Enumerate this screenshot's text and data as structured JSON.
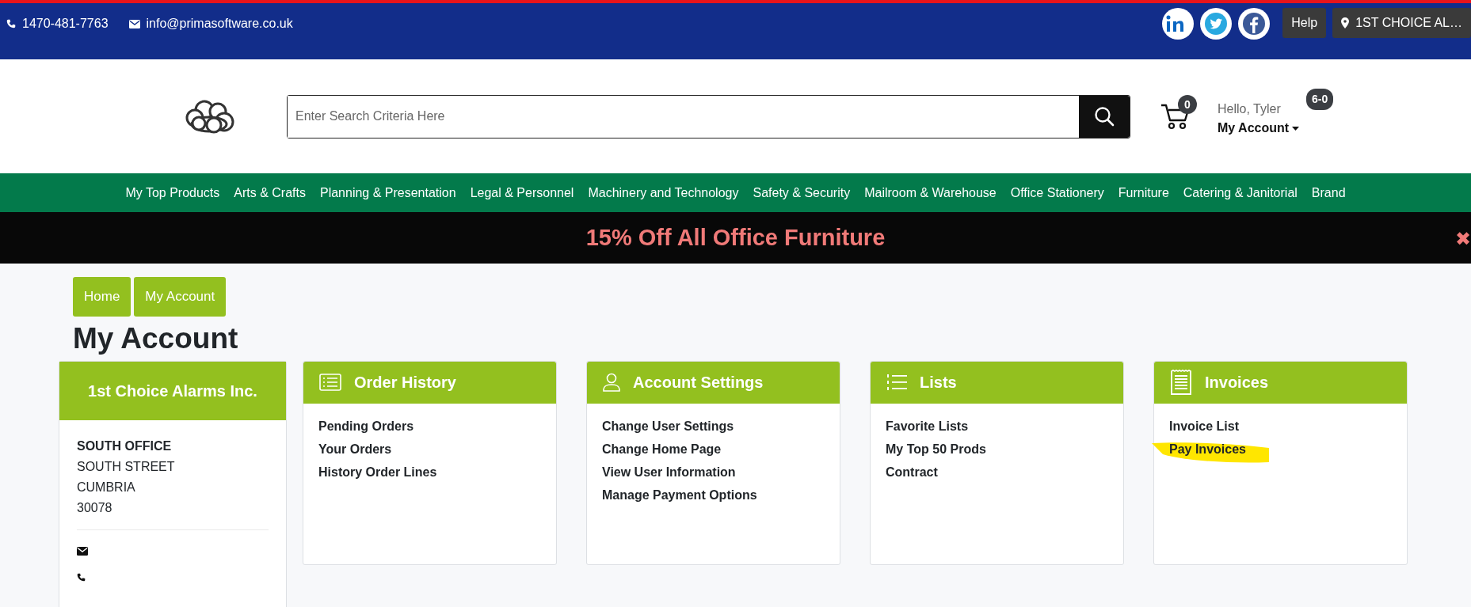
{
  "top_bar": {
    "phone": "1470-481-7763",
    "email": "info@primasoftware.co.uk",
    "help": "Help",
    "location": "1ST CHOICE AL…"
  },
  "header": {
    "search_placeholder": "Enter Search Criteria Here",
    "cart_count": "0",
    "greeting": "Hello, Tyler",
    "account_menu": "My Account",
    "badge": "6-0"
  },
  "nav": [
    "My Top Products",
    "Arts & Crafts",
    "Planning & Presentation",
    "Legal & Personnel",
    "Machinery and Technology",
    "Safety & Security",
    "Mailroom & Warehouse",
    "Office Stationery",
    "Furniture",
    "Catering & Janitorial",
    "Brand"
  ],
  "promo": {
    "text": "15% Off All Office Furniture",
    "close": "✖"
  },
  "breadcrumbs": [
    "Home",
    "My Account"
  ],
  "page_title": "My Account",
  "address_card": {
    "title": "1st Choice Alarms Inc.",
    "name": "SOUTH OFFICE",
    "lines": [
      "SOUTH STREET",
      "CUMBRIA",
      "30078"
    ]
  },
  "panels": [
    {
      "kind": "list",
      "title": "Order History",
      "links": [
        {
          "label": "Pending Orders",
          "highlighted": false
        },
        {
          "label": "Your Orders",
          "highlighted": false
        },
        {
          "label": "History Order Lines",
          "highlighted": false
        }
      ]
    },
    {
      "kind": "user",
      "title": "Account Settings",
      "links": [
        {
          "label": "Change User Settings",
          "highlighted": false
        },
        {
          "label": "Change Home Page",
          "highlighted": false
        },
        {
          "label": "View User Information",
          "highlighted": false
        },
        {
          "label": "Manage Payment Options",
          "highlighted": false
        }
      ]
    },
    {
      "kind": "numbered",
      "title": "Lists",
      "links": [
        {
          "label": "Favorite Lists",
          "highlighted": false
        },
        {
          "label": "My Top 50 Prods",
          "highlighted": false
        },
        {
          "label": "Contract",
          "highlighted": false
        }
      ]
    },
    {
      "kind": "receipt",
      "title": "Invoices",
      "links": [
        {
          "label": "Invoice List",
          "highlighted": false
        },
        {
          "label": "Pay Invoices",
          "highlighted": true
        }
      ]
    }
  ]
}
